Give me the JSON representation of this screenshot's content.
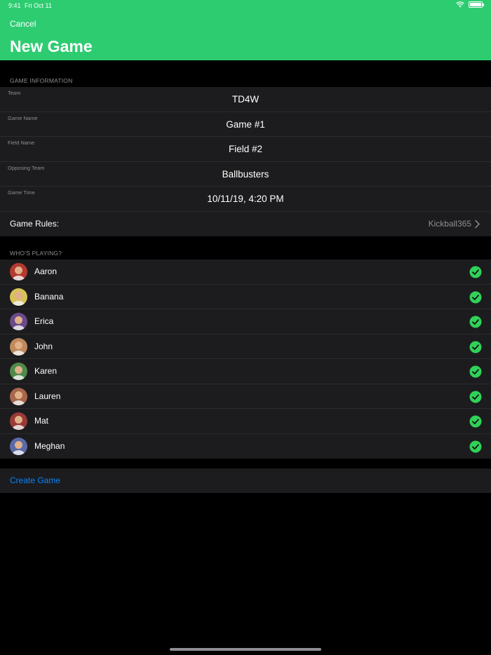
{
  "status_bar": {
    "time": "9:41",
    "date": "Fri Oct 11",
    "battery_level": 1.0
  },
  "nav": {
    "cancel_label": "Cancel",
    "title": "New Game"
  },
  "game_info": {
    "section_title": "GAME INFORMATION",
    "fields": [
      {
        "label": "Team",
        "value": "TD4W"
      },
      {
        "label": "Game Name",
        "value": "Game #1"
      },
      {
        "label": "Field Name",
        "value": "Field #2"
      },
      {
        "label": "Opposing Team",
        "value": "Ballbusters"
      },
      {
        "label": "Game Time",
        "value": "10/11/19, 4:20 PM"
      }
    ],
    "rules_label": "Game Rules:",
    "rules_value": "Kickball365"
  },
  "players": {
    "section_title": "WHO'S PLAYING?",
    "items": [
      {
        "name": "Aaron",
        "selected": true,
        "avatar_color": "#b33a2e"
      },
      {
        "name": "Banana",
        "selected": true,
        "avatar_color": "#d9c25a"
      },
      {
        "name": "Erica",
        "selected": true,
        "avatar_color": "#6b4a8a"
      },
      {
        "name": "John",
        "selected": true,
        "avatar_color": "#c08a5c"
      },
      {
        "name": "Karen",
        "selected": true,
        "avatar_color": "#4f8a4a"
      },
      {
        "name": "Lauren",
        "selected": true,
        "avatar_color": "#a8684a"
      },
      {
        "name": "Mat",
        "selected": true,
        "avatar_color": "#9a3a36"
      },
      {
        "name": "Meghan",
        "selected": true,
        "avatar_color": "#5a6aa8"
      }
    ]
  },
  "actions": {
    "create_label": "Create Game"
  },
  "colors": {
    "accent_green": "#2ecc71",
    "check_green": "#30d158",
    "link_blue": "#0a84ff"
  }
}
